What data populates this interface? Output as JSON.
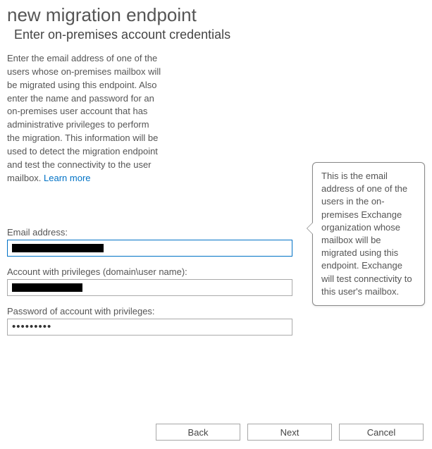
{
  "header": {
    "title": "new migration endpoint",
    "subtitle": "Enter on-premises account credentials"
  },
  "description": {
    "text": "Enter the email address of one of the users whose on-premises mailbox will be migrated using this endpoint. Also enter the name and password for an on-premises user account that has administrative privileges to perform the migration. This information will be used to detect the migration endpoint and test the connectivity to the user mailbox. ",
    "learn_more_label": "Learn more"
  },
  "form": {
    "email_label": "Email address:",
    "email_value": "",
    "account_label": "Account with privileges (domain\\user name):",
    "account_value": "",
    "password_label": "Password of account with privileges:",
    "password_value": "•••••••••"
  },
  "tooltip": {
    "text": "This is the email address of one of the users in the on-premises Exchange organization whose mailbox will be migrated using this endpoint. Exchange will test connectivity to this user's mailbox."
  },
  "buttons": {
    "back": "Back",
    "next": "Next",
    "cancel": "Cancel"
  }
}
